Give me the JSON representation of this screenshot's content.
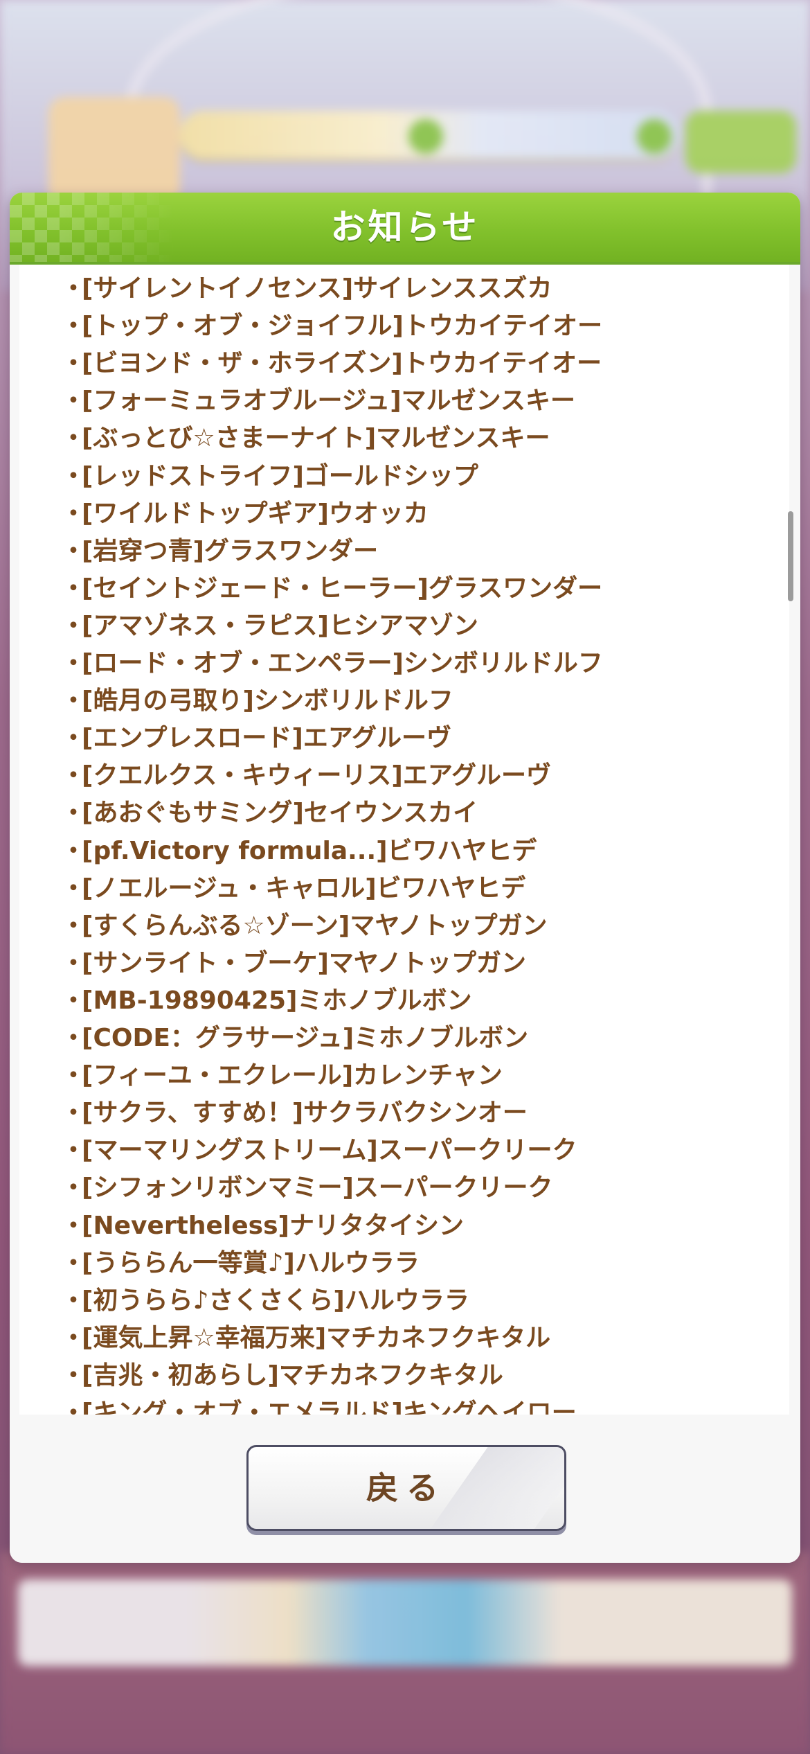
{
  "dialog": {
    "title": "お知らせ",
    "back_label": "戻る"
  },
  "items": [
    "[サイレントイノセンス]サイレンススズカ",
    "[トップ・オブ・ジョイフル]トウカイテイオー",
    "[ビヨンド・ザ・ホライズン]トウカイテイオー",
    "[フォーミュラオブルージュ]マルゼンスキー",
    "[ぶっとび☆さまーナイト]マルゼンスキー",
    "[レッドストライフ]ゴールドシップ",
    "[ワイルドトップギア]ウオッカ",
    "[岩穿つ青]グラスワンダー",
    "[セイントジェード・ヒーラー]グラスワンダー",
    "[アマゾネス・ラピス]ヒシアマゾン",
    "[ロード・オブ・エンペラー]シンボリルドルフ",
    "[皓月の弓取り]シンボリルドルフ",
    "[エンプレスロード]エアグルーヴ",
    "[クエルクス・キウィーリス]エアグルーヴ",
    "[あおぐもサミング]セイウンスカイ",
    "[pf.Victory formula...]ビワハヤヒデ",
    "[ノエルージュ・キャロル]ビワハヤヒデ",
    "[すくらんぶる☆ゾーン]マヤノトップガン",
    "[サンライト・ブーケ]マヤノトップガン",
    "[MB-19890425]ミホノブルボン",
    "[CODE：グラサージュ]ミホノブルボン",
    "[フィーユ・エクレール]カレンチャン",
    "[サクラ、すすめ！]サクラバクシンオー",
    "[マーマリングストリーム]スーパークリーク",
    "[シフォンリボンマミー]スーパークリーク",
    "[Nevertheless]ナリタタイシン",
    "[うららん一等賞♪]ハルウララ",
    "[初うらら♪さくさくら]ハルウララ",
    "[運気上昇☆幸福万来]マチカネフクキタル",
    "[吉兆・初あらし]マチカネフクキタル",
    "[キング・オブ・エメラルド]キングヘイロー"
  ],
  "bullet": "・",
  "colors": {
    "header_green": "#82c12c",
    "item_text_brown": "#7a4a1f",
    "button_text_brown": "#6d4522",
    "backdrop_magenta": "#91577a"
  }
}
